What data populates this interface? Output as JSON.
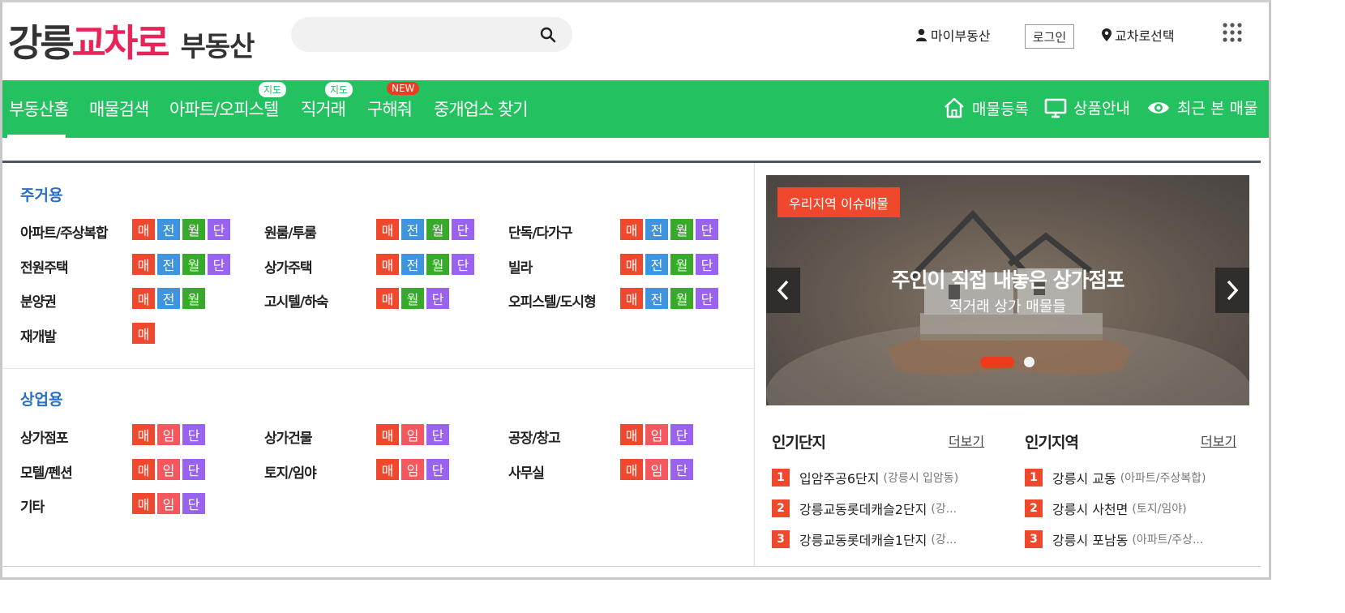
{
  "header": {
    "logo": {
      "part1": "강릉",
      "part2": "교차로",
      "part3": "부동산"
    },
    "search": {
      "placeholder": ""
    },
    "my_realestate": "마이부동산",
    "login": "로그인",
    "region_select": "교차로선택"
  },
  "nav": {
    "items": [
      {
        "label": "부동산홈",
        "active": true
      },
      {
        "label": "매물검색"
      },
      {
        "label": "아파트/오피스텔",
        "badge": "지도"
      },
      {
        "label": "직거래",
        "badge": "지도"
      },
      {
        "label": "구해줘",
        "badge": "NEW"
      },
      {
        "label": "중개업소 찾기"
      }
    ],
    "right": [
      {
        "label": "매물등록",
        "icon": "home-icon"
      },
      {
        "label": "상품안내",
        "icon": "monitor-icon"
      },
      {
        "label": "최근 본 매물",
        "icon": "eye-icon"
      }
    ]
  },
  "tag_labels": {
    "sale": "매",
    "jeonse": "전",
    "wolse": "월",
    "danki": "단",
    "imdae": "임"
  },
  "residential": {
    "title": "주거용",
    "rows": [
      {
        "label": "아파트/주상복합",
        "tags": [
          "매",
          "전",
          "월",
          "단"
        ]
      },
      {
        "label": "원룸/투룸",
        "tags": [
          "매",
          "전",
          "월",
          "단"
        ]
      },
      {
        "label": "단독/다가구",
        "tags": [
          "매",
          "전",
          "월",
          "단"
        ]
      },
      {
        "label": "전원주택",
        "tags": [
          "매",
          "전",
          "월",
          "단"
        ]
      },
      {
        "label": "상가주택",
        "tags": [
          "매",
          "전",
          "월",
          "단"
        ]
      },
      {
        "label": "빌라",
        "tags": [
          "매",
          "전",
          "월",
          "단"
        ]
      },
      {
        "label": "분양권",
        "tags": [
          "매",
          "전",
          "월"
        ]
      },
      {
        "label": "고시텔/하숙",
        "tags": [
          "매",
          "월",
          "단"
        ]
      },
      {
        "label": "오피스텔/도시형",
        "tags": [
          "매",
          "전",
          "월",
          "단"
        ]
      },
      {
        "label": "재개발",
        "tags": [
          "매"
        ]
      }
    ]
  },
  "commercial": {
    "title": "상업용",
    "rows": [
      {
        "label": "상가점포",
        "tags": [
          "매",
          "임",
          "단"
        ]
      },
      {
        "label": "상가건물",
        "tags": [
          "매",
          "임",
          "단"
        ]
      },
      {
        "label": "공장/창고",
        "tags": [
          "매",
          "임",
          "단"
        ]
      },
      {
        "label": "모텔/펜션",
        "tags": [
          "매",
          "임",
          "단"
        ]
      },
      {
        "label": "토지/임야",
        "tags": [
          "매",
          "임",
          "단"
        ]
      },
      {
        "label": "사무실",
        "tags": [
          "매",
          "임",
          "단"
        ]
      },
      {
        "label": "기타",
        "tags": [
          "매",
          "임",
          "단"
        ]
      }
    ]
  },
  "banner": {
    "label": "우리지역 이슈매물",
    "title": "주인이 직접 내놓은 상가점포",
    "subtitle": "직거래 상가 매물들",
    "slide_count": 2,
    "active_slide": 1
  },
  "popular_complex": {
    "title": "인기단지",
    "more": "더보기",
    "items": [
      {
        "rank": "1",
        "name": "입암주공6단지",
        "sub": "(강릉시 입암동)"
      },
      {
        "rank": "2",
        "name": "강릉교동롯데캐슬2단지",
        "sub": "(강..."
      },
      {
        "rank": "3",
        "name": "강릉교동롯데캐슬1단지",
        "sub": "(강..."
      }
    ]
  },
  "popular_region": {
    "title": "인기지역",
    "more": "더보기",
    "items": [
      {
        "rank": "1",
        "name": "강릉시 교동",
        "sub": "(아파트/주상복합)"
      },
      {
        "rank": "2",
        "name": "강릉시 사천면",
        "sub": "(토지/임야)"
      },
      {
        "rank": "3",
        "name": "강릉시 포남동",
        "sub": "(아파트/주상..."
      }
    ]
  },
  "colors": {
    "nav_green": "#24c160",
    "brand_pink": "#e8255a",
    "sale": "#f0482d",
    "jeonse": "#3f94e0",
    "wolse": "#37a92b",
    "danki": "#9a63ef",
    "imdae": "#f4585e",
    "section_blue": "#2a6fc2"
  }
}
